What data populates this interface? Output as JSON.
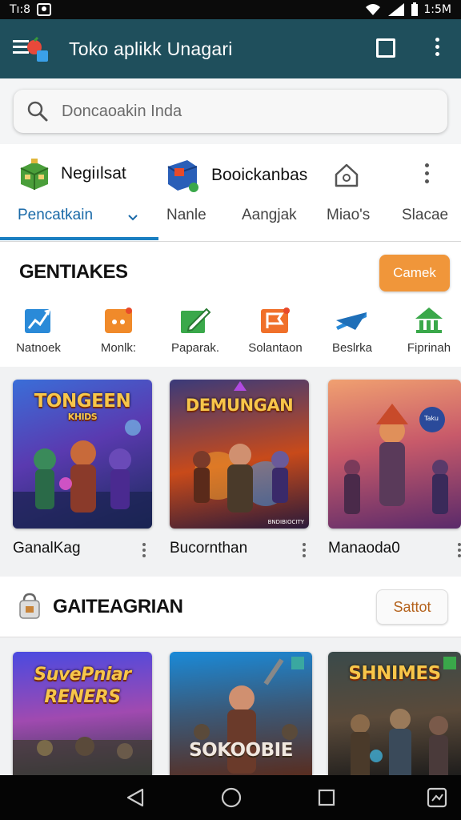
{
  "status_bar": {
    "time_left": "Tı:8",
    "time_right": "1:5M"
  },
  "app_bar": {
    "title": "Toko aplikk Unagari",
    "menu_icon": "menu-icon",
    "window_icon": "square-icon",
    "more_icon": "more-vert-icon",
    "color": "#1f4f5c"
  },
  "search": {
    "placeholder": "Doncaoakin Inda"
  },
  "top_apps": [
    {
      "label": "Negiılsat",
      "icon": "green-box-app-icon"
    },
    {
      "label": "Booickanbas",
      "icon": "blue-box-app-icon"
    }
  ],
  "tabs": [
    {
      "label": "Pencatkain",
      "active": true
    },
    {
      "label": "Nanle"
    },
    {
      "label": "Aangjak"
    },
    {
      "label": "Miao's"
    },
    {
      "label": "Slacae"
    }
  ],
  "section1": {
    "title": "GENTIAKES",
    "button": "Camek",
    "categories": [
      {
        "label": "Natnoek",
        "icon": "blue-chart-icon",
        "color": "#2a8ad8"
      },
      {
        "label": "Monlk:",
        "icon": "orange-chat-icon",
        "color": "#f08a2a"
      },
      {
        "label": "Paparak.",
        "icon": "green-edit-icon",
        "color": "#3aa84a"
      },
      {
        "label": "Solantaon",
        "icon": "orange-flag-icon",
        "color": "#f0702a"
      },
      {
        "label": "Beslrka",
        "icon": "blue-mail-icon",
        "color": "#2a8ad8"
      },
      {
        "label": "Fiprinah",
        "icon": "green-bank-icon",
        "color": "#3aa84a"
      }
    ],
    "games": [
      {
        "name": "GanalKag",
        "art_text_1": "TONGEEN",
        "art_text_2": "KHIDS"
      },
      {
        "name": "Bucornthan",
        "art_text_1": "DEMUNGAN",
        "art_badge": "BNDIBIOCITY"
      },
      {
        "name": "Manaoda0",
        "art_badge": "Taku"
      }
    ]
  },
  "section2": {
    "title": "GAITEAGRIAN",
    "button": "Sattot",
    "games": [
      {
        "art_text_1": "SuvePniar",
        "art_text_2": "RENERS"
      },
      {
        "art_text_1": "SOKOOBIE"
      },
      {
        "art_text_1": "SHNIMES"
      }
    ]
  },
  "navbar": {
    "back_icon": "back-triangle-icon",
    "home_icon": "home-circle-icon",
    "recents_icon": "recents-square-icon",
    "assist_icon": "screenshot-icon"
  }
}
